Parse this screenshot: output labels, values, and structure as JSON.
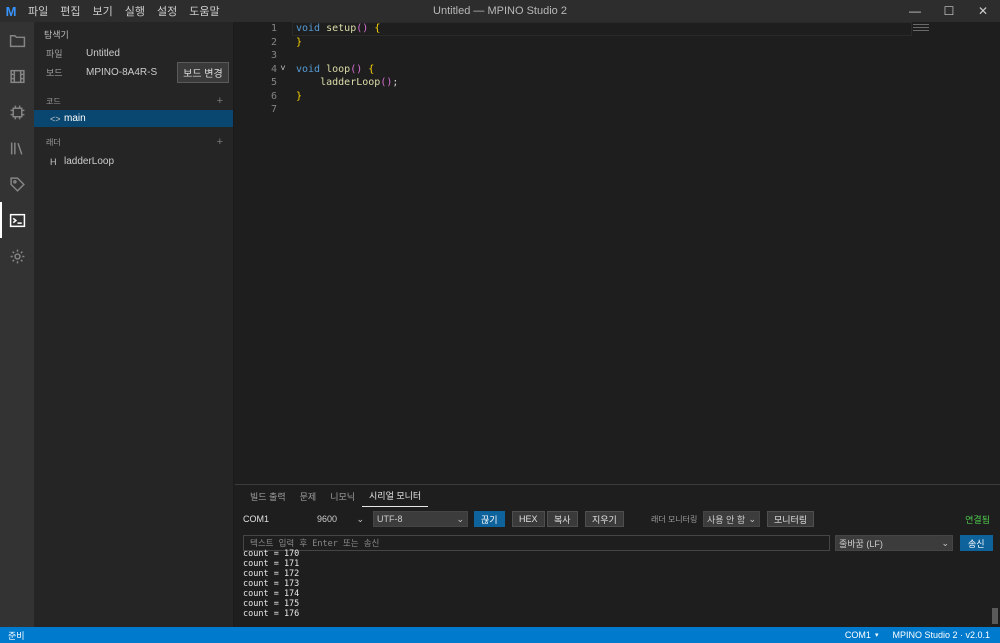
{
  "titlebar": {
    "logo": "M",
    "menu": [
      "파일",
      "편집",
      "보기",
      "실행",
      "설정",
      "도움말"
    ],
    "title": "Untitled — MPINO Studio 2",
    "controls": [
      "—",
      "☐",
      "✕"
    ]
  },
  "activity": [
    "folder-icon",
    "film-icon",
    "chip-icon",
    "library-icon",
    "tag-icon",
    "terminal-icon",
    "gear-icon"
  ],
  "sidebar": {
    "title": "탐색기",
    "file_key": "파일",
    "file_value": "Untitled",
    "board_key": "보드",
    "board_value": "MPINO-8A4R-S",
    "board_button": "보드 변경",
    "code_section": "코드",
    "code_items": [
      {
        "icon": "<>",
        "label": "main"
      }
    ],
    "ladder_section": "래더",
    "ladder_items": [
      {
        "icon": "H",
        "label": "ladderLoop"
      }
    ],
    "plus": "+"
  },
  "editor": {
    "line_numbers": [
      "1",
      "2",
      "3",
      "4",
      "5",
      "6",
      "7"
    ],
    "fold_marker": "˅"
  },
  "panel": {
    "tabs": [
      "빌드 출력",
      "문제",
      "니모닉",
      "시리얼 모니터"
    ],
    "port": "COM1",
    "baud": "9600",
    "encoding": "UTF-8",
    "disconnect_button": "끊기",
    "hex_button": "HEX",
    "copy_button": "복사",
    "clear_button": "지우기",
    "ladder_monitor_label": "래더 모니터링",
    "ladder_monitor_value": "사용 안 함",
    "monitor_button": "모니터링",
    "status_connected": "연결됨",
    "input_placeholder": "텍스트 입력 후 Enter 또는 송신",
    "line_ending": "줄바꿈 (LF)",
    "send_button": "송신",
    "output": [
      "count = 170",
      "count = 171",
      "count = 172",
      "count = 173",
      "count = 174",
      "count = 175",
      "count = 176"
    ]
  },
  "statusbar": {
    "left": "준비",
    "port": "COM1",
    "version": "MPINO Studio 2 · v2.0.1"
  },
  "colors": {
    "accent": "#007acc",
    "selection": "#094771",
    "connected": "#4ec94e",
    "keyword": "#569cd6",
    "function": "#dcdcaa",
    "bracket": "#ffd700"
  }
}
